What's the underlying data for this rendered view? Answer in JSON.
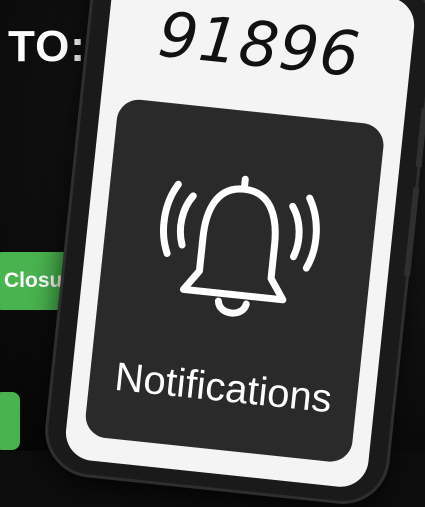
{
  "header": {
    "to_label": "TO:"
  },
  "buttons": {
    "closures_label": "Closures",
    "bottom_label": ""
  },
  "phone": {
    "number": "91896",
    "notification_label": "Notifications",
    "icon": "bell-ringing-icon"
  },
  "colors": {
    "background": "#0d0d0d",
    "accent_green": "#49b34f",
    "card": "#2a2a2a",
    "screen": "#f4f4f4"
  }
}
